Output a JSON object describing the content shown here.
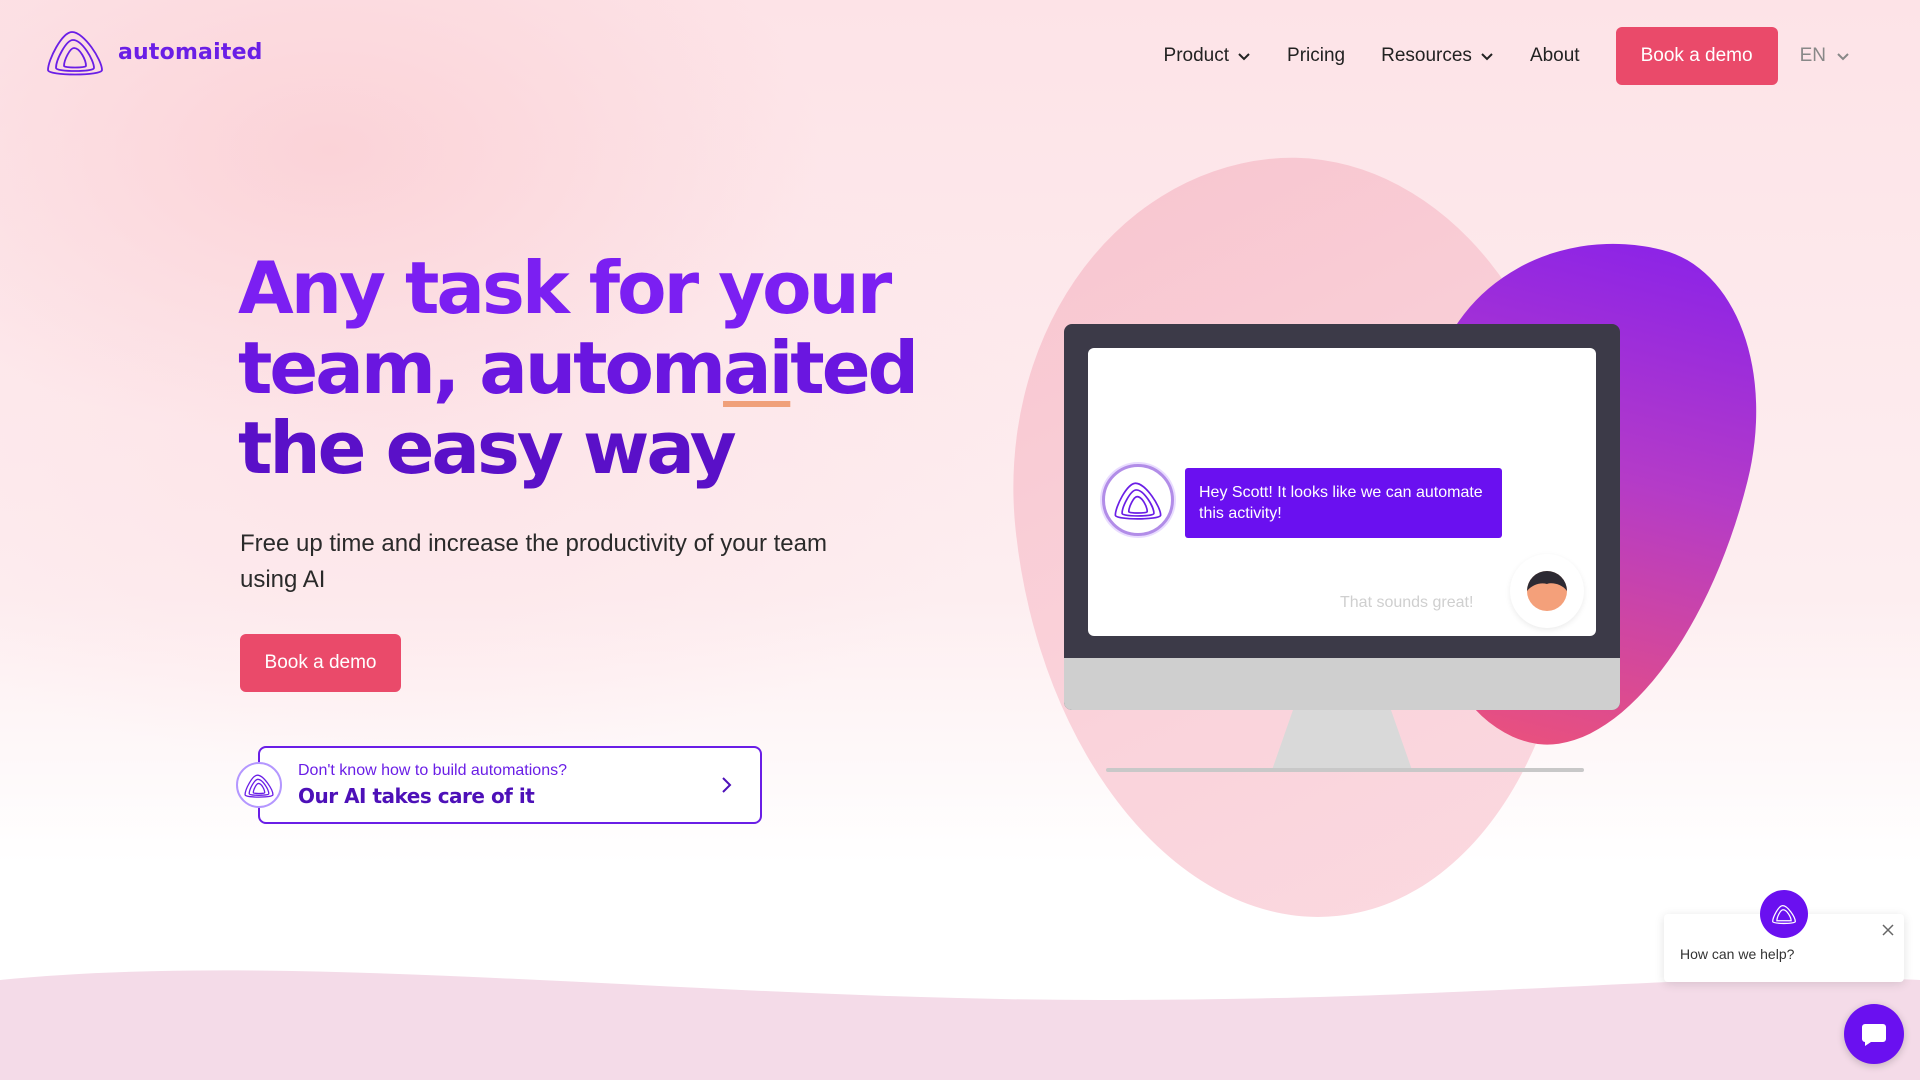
{
  "brand": {
    "name": "automaited",
    "logo_icon": "automaited-logo-icon"
  },
  "nav": {
    "items": [
      {
        "label": "Product",
        "has_dropdown": true
      },
      {
        "label": "Pricing",
        "has_dropdown": false
      },
      {
        "label": "Resources",
        "has_dropdown": true
      },
      {
        "label": "About",
        "has_dropdown": false
      }
    ],
    "cta_label": "Book a demo",
    "language": "EN"
  },
  "hero": {
    "headline_line1": "Any task for your",
    "headline_line2_a": "team, autom",
    "headline_line2_ai": "ai",
    "headline_line2_b": "ted",
    "headline_line3": "the easy way",
    "subtext": "Free up time and increase the productivity of your team using AI",
    "cta_label": "Book a demo"
  },
  "ai_card": {
    "small_text": "Don't know how to build automations?",
    "big_text": "Our AI takes care of it"
  },
  "illustration": {
    "bot_message": "Hey Scott! It looks like we can automate this activity!",
    "user_reply": "That sounds great!"
  },
  "chat_widget": {
    "prompt": "How can we help?"
  },
  "colors": {
    "brand_purple": "#6a1ee6",
    "cta_red": "#ea4a6a",
    "bubble_purple": "#6a10f0"
  }
}
